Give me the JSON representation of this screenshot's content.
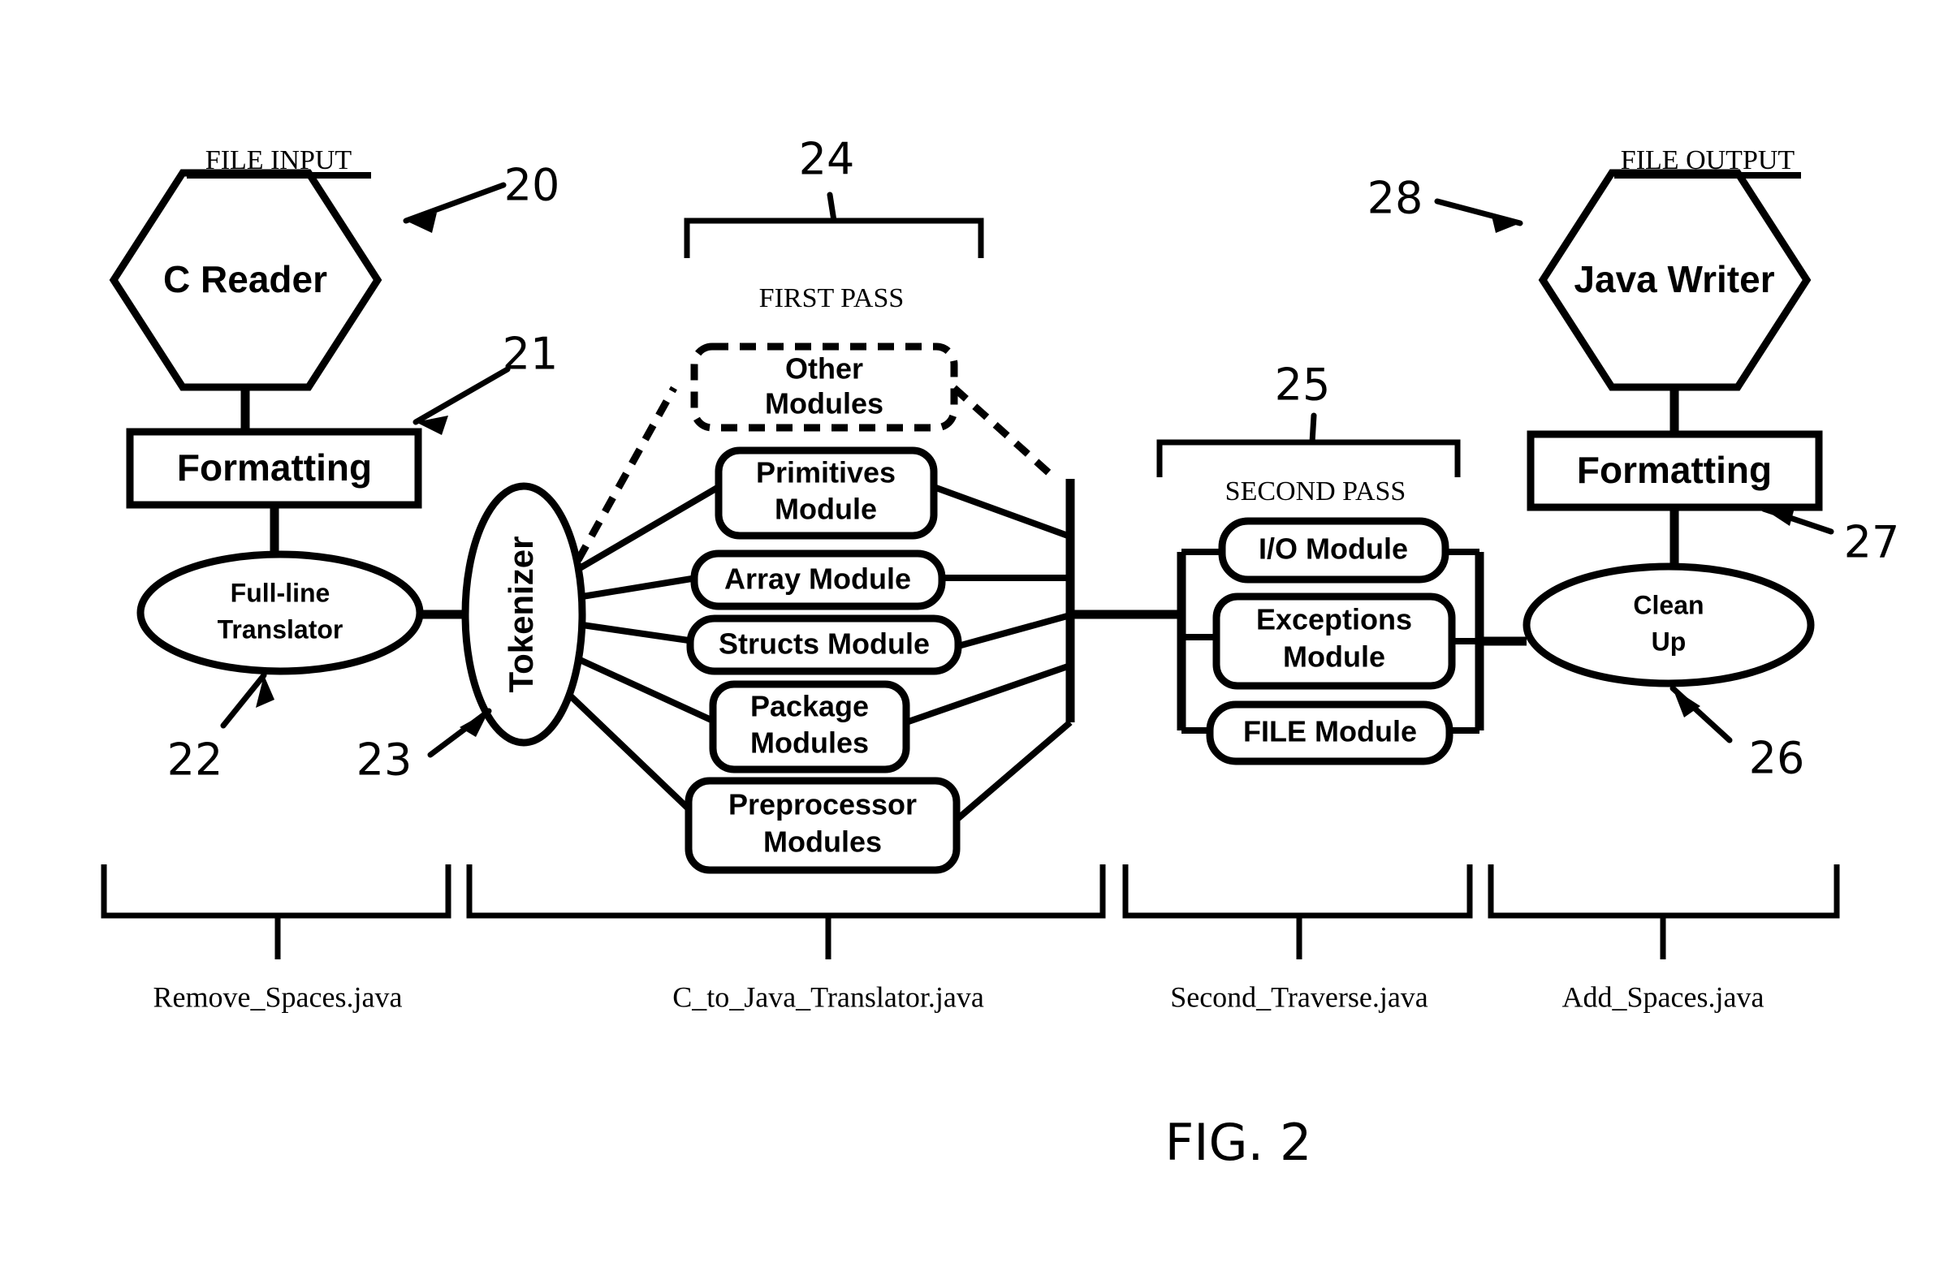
{
  "figure": {
    "caption": "FIG. 2",
    "input_label": "FILE INPUT",
    "output_label": "FILE OUTPUT"
  },
  "nodes": {
    "c_reader": "C Reader",
    "java_writer": "Java Writer",
    "formatting_in": "Formatting",
    "formatting_out": "Formatting",
    "full_line_translator_line1": "Full-line",
    "full_line_translator_line2": "Translator",
    "tokenizer": "Tokenizer",
    "clean_up_line1": "Clean",
    "clean_up_line2": "Up"
  },
  "passes": {
    "first": {
      "label": "FIRST PASS",
      "ref": "24",
      "modules": [
        {
          "line1": "Other",
          "line2": "Modules",
          "dashed": true
        },
        {
          "line1": "Primitives",
          "line2": "Module",
          "dashed": false
        },
        {
          "line1": "Array Module",
          "line2": "",
          "dashed": false
        },
        {
          "line1": "Structs Module",
          "line2": "",
          "dashed": false
        },
        {
          "line1": "Package",
          "line2": "Modules",
          "dashed": false
        },
        {
          "line1": "Preprocessor",
          "line2": "Modules",
          "dashed": false
        }
      ]
    },
    "second": {
      "label": "SECOND PASS",
      "ref": "25",
      "modules": [
        {
          "line1": "I/O Module",
          "line2": ""
        },
        {
          "line1": "Exceptions",
          "line2": "Module"
        },
        {
          "line1": "FILE Module",
          "line2": ""
        }
      ]
    }
  },
  "reference_numerals": {
    "n20": "20",
    "n21": "21",
    "n22": "22",
    "n23": "23",
    "n24": "24",
    "n25": "25",
    "n26": "26",
    "n27": "27",
    "n28": "28"
  },
  "source_files": [
    "Remove_Spaces.java",
    "C_to_Java_Translator.java",
    "Second_Traverse.java",
    "Add_Spaces.java"
  ],
  "colors": {
    "ink": "#000000",
    "paper": "#ffffff"
  }
}
